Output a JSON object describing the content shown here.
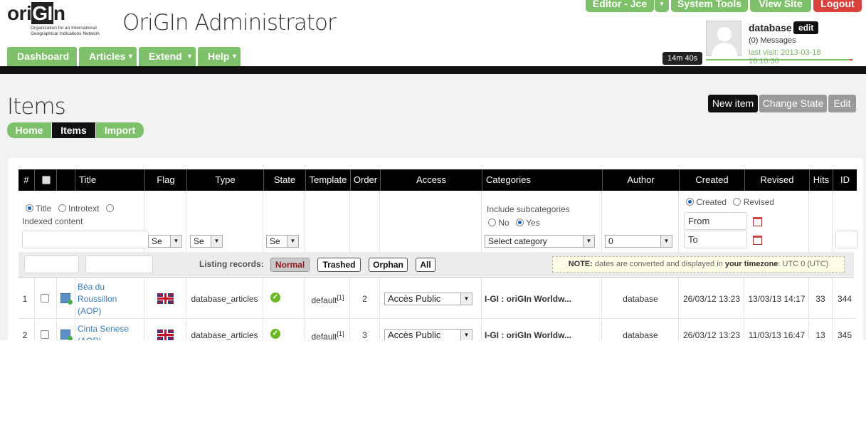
{
  "header": {
    "logo_word_a": "ori",
    "logo_word_b": "GI",
    "logo_word_c": "n",
    "logo_tagline": "Organization for an International Geographical Indications Network",
    "app_title": "OriGIn Administrator",
    "top_buttons": {
      "editor": "Editor - Jce",
      "caret": "▾",
      "system_tools": "System Tools",
      "view_site": "View Site",
      "logout": "Logout"
    },
    "user": {
      "name": "database",
      "edit": "edit",
      "messages": "(0) Messages",
      "last_visit": "last visit: 2013-03-18 18:10:30"
    },
    "timer": "14m 40s",
    "main_nav": [
      {
        "label": "Dashboard",
        "arrow": ""
      },
      {
        "label": "Articles",
        "arrow": "▾"
      },
      {
        "label": "Extend",
        "arrow": "▾"
      },
      {
        "label": "Help",
        "arrow": "▾"
      }
    ]
  },
  "page": {
    "title": "Items",
    "sub_nav": [
      "Home",
      "Items",
      "Import"
    ],
    "actions": {
      "new_item": "New item",
      "change_state": "Change State",
      "edit": "Edit"
    }
  },
  "table": {
    "columns": [
      "#",
      "",
      "",
      "Title",
      "Flag",
      "Type",
      "State",
      "Template",
      "Order",
      "Access",
      "Categories",
      "Author",
      "Created",
      "Revised",
      "Hits",
      "ID"
    ],
    "filters": {
      "search_modes": [
        "Title",
        "Introtext",
        "Indexed content"
      ],
      "flag_select": "Se",
      "type_select": "Se",
      "state_select": "Se",
      "include_subcategories": "Include subcategories",
      "subcat_no": "No",
      "subcat_yes": "Yes",
      "category_select": "Select category",
      "author_select": "0",
      "date_created": "Created",
      "date_revised": "Revised",
      "from": "From",
      "to": "To"
    },
    "listing": {
      "label": "Listing records:",
      "options": [
        "Normal",
        "Trashed",
        "Orphan",
        "All"
      ],
      "note_bold": "NOTE:",
      "note_text": "dates are converted and displayed in",
      "note_tz_bold": "your timezone",
      "note_tz": ": UTC 0 (UTC)"
    },
    "rows": [
      {
        "num": "1",
        "title": "Béa du Roussillon (AOP)",
        "type": "database_articles",
        "template": "default",
        "template_sup": "[1]",
        "order": "2",
        "access": "Accès Public",
        "category": "I-GI : oriGIn Worldw...",
        "author": "database",
        "created": "26/03/12 13:23",
        "revised": "13/03/13 14:17",
        "hits": "33",
        "id": "344"
      },
      {
        "num": "2",
        "title": "Cinta Senese (AOP)",
        "type": "database_articles",
        "template": "default",
        "template_sup": "[1]",
        "order": "3",
        "access": "Accès Public",
        "category": "I-GI : oriGIn Worldw...",
        "author": "database",
        "created": "26/03/12 13:23",
        "revised": "11/03/13 16:47",
        "hits": "13",
        "id": "345"
      }
    ]
  },
  "colors": {
    "green": "#7fc16b",
    "red": "#d9413c",
    "black": "#111111",
    "link": "#3d7cb8"
  }
}
